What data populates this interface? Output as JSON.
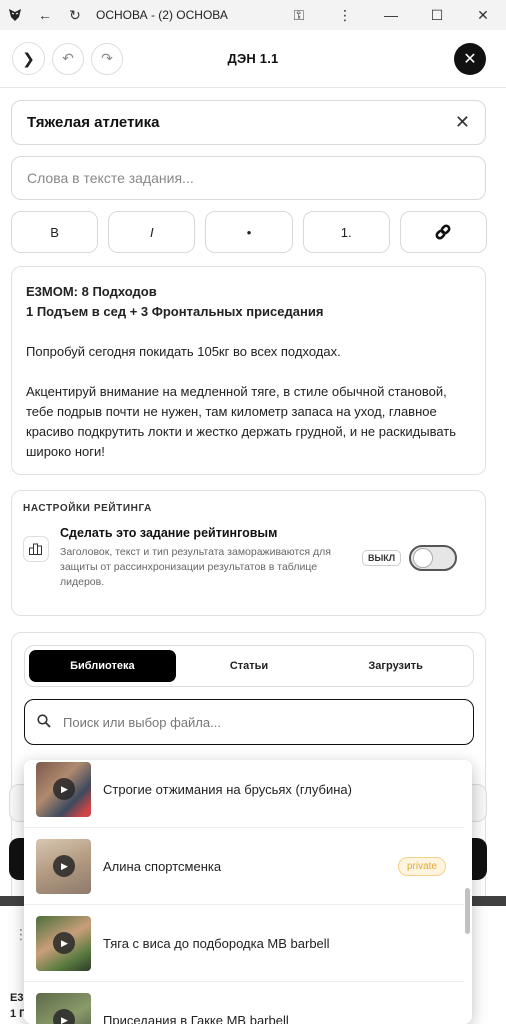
{
  "browser": {
    "title": "ОСНОВА - (2) ОСНОВА",
    "icons": [
      "app-logo-icon",
      "back-arrow-icon",
      "reload-icon",
      "key-icon",
      "more-icon",
      "minimize-icon",
      "maximize-icon",
      "close-icon"
    ]
  },
  "header": {
    "title": "ДЭН 1.1"
  },
  "form": {
    "title_value": "Тяжелая атлетика",
    "keywords_placeholder": "Слова в тексте задания...",
    "format_buttons": [
      "B",
      "I",
      "•",
      "1.",
      "🔗"
    ]
  },
  "description": {
    "line1": "E3MOM: 8 Подходов",
    "line2": "1 Подъем в сед + 3 Фронтальных приседания",
    "para1": "Попробуй сегодня покидать 105кг во всех подходах.",
    "para2": "Акцентируй внимание на медленной тяге, в стиле обычной становой, тебе подрыв почти не нужен, там километр запаса на уход, главное красиво подкрутить локти и жестко держать грудной, и не раскидывать широко ноги!"
  },
  "rating": {
    "heading": "НАСТРОЙКИ РЕЙТИНГА",
    "toggle_title": "Сделать это задание рейтинговым",
    "toggle_desc": "Заголовок, текст и тип результата замораживаются для защиты от рассинхронизации результатов в таблице лидеров.",
    "toggle_state_label": "ВЫКЛ",
    "enabled": false
  },
  "media": {
    "tabs": [
      "Библиотека",
      "Статьи",
      "Загрузить"
    ],
    "active_tab": "Библиотека",
    "search_placeholder": "Поиск или выбор файла..."
  },
  "dropdown": {
    "items": [
      {
        "label": "Строгие отжимания на брусьях (глубина)",
        "badge": ""
      },
      {
        "label": "Алина спортсменка",
        "badge": "private"
      },
      {
        "label": "Тяга с виса до подбородка MB barbell",
        "badge": ""
      },
      {
        "label": "Приседания в Гакке MB barbell",
        "badge": ""
      }
    ]
  },
  "background": {
    "peek1": "E3",
    "peek2": "1 П"
  }
}
